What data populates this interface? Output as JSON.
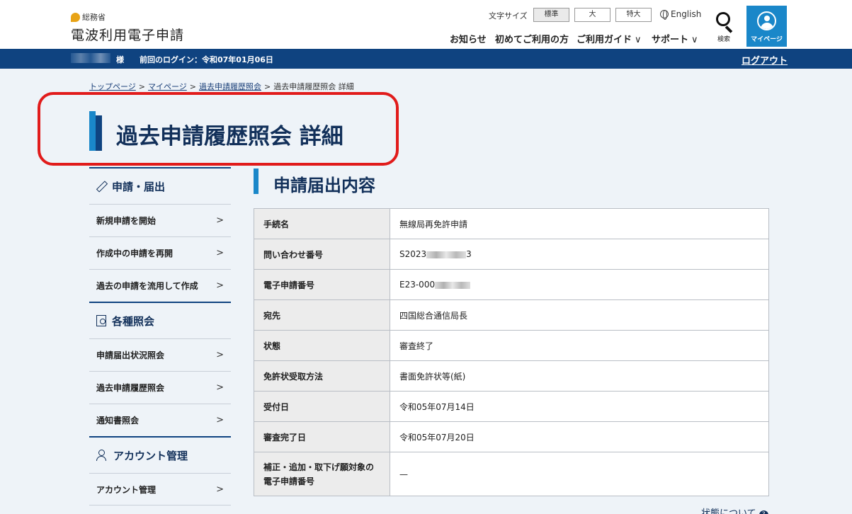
{
  "header": {
    "ministry": "総務省",
    "site_title": "電波利用電子申請",
    "font_size_label": "文字サイズ",
    "font_sizes": [
      "標準",
      "大",
      "特大"
    ],
    "english": "English",
    "nav": [
      "お知らせ",
      "初めてご利用の方",
      "ご利用ガイド",
      "サポート"
    ],
    "search_label": "検索",
    "mypage_label": "マイページ"
  },
  "loginbar": {
    "honorific": "様",
    "last_login": "前回のログイン：令和07年01月06日",
    "logout": "ログアウト"
  },
  "breadcrumb": [
    "トップページ",
    "マイページ",
    "過去申請履歴照会",
    "過去申請履歴照会 詳細"
  ],
  "page_title": "過去申請履歴照会 詳細",
  "sidebar": {
    "sections": [
      {
        "title": "申請・届出",
        "icon": "pen-icon",
        "items": [
          "新規申請を開始",
          "作成中の申請を再開",
          "過去の申請を流用して作成"
        ]
      },
      {
        "title": "各種照会",
        "icon": "document-search-icon",
        "items": [
          "申請届出状況照会",
          "過去申請履歴照会",
          "通知書照会"
        ]
      },
      {
        "title": "アカウント管理",
        "icon": "user-gear-icon",
        "items": [
          "アカウント管理"
        ]
      }
    ]
  },
  "main": {
    "section_title": "申請届出内容",
    "rows": [
      {
        "label": "手続名",
        "value": "無線局再免許申請"
      },
      {
        "label": "問い合わせ番号",
        "value_prefix": "S2023",
        "value_suffix": "3"
      },
      {
        "label": "電子申請番号",
        "value_prefix": "E23-000",
        "value_suffix": ""
      },
      {
        "label": "宛先",
        "value": "四国総合通信局長"
      },
      {
        "label": "状態",
        "value": "審査終了"
      },
      {
        "label": "免許状受取方法",
        "value": "書面免許状等(紙)"
      },
      {
        "label": "受付日",
        "value": "令和05年07月14日"
      },
      {
        "label": "審査完了日",
        "value": "令和05年07月20日"
      },
      {
        "label": "補正・追加・取下げ願対象の電子申請番号",
        "value": "—"
      }
    ],
    "status_link": "状態について"
  },
  "colors": {
    "primary_dark": "#0f4380",
    "accent": "#1a87c9",
    "highlight": "#e11b1b"
  }
}
